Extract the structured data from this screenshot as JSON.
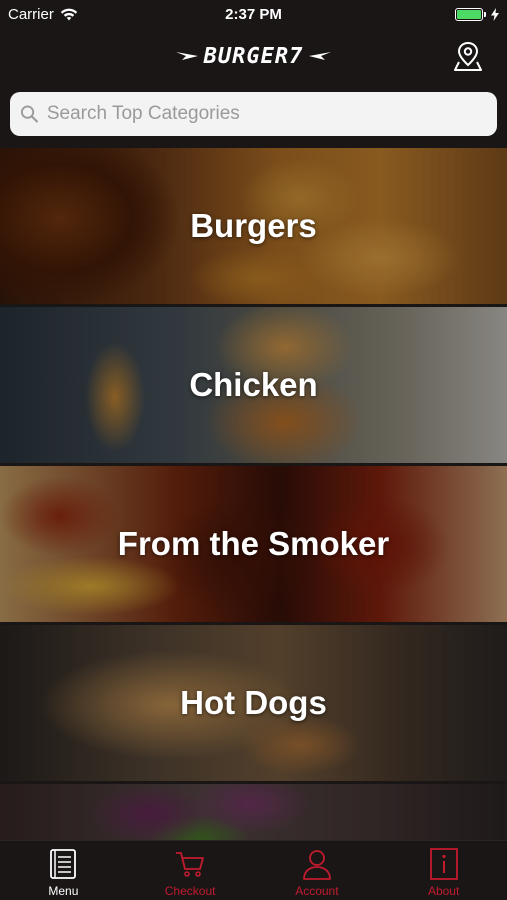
{
  "status_bar": {
    "carrier": "Carrier",
    "time": "2:37 PM"
  },
  "header": {
    "logo_text": "BURGER7"
  },
  "search": {
    "placeholder": "Search Top Categories"
  },
  "categories": [
    {
      "label": "Burgers"
    },
    {
      "label": "Chicken"
    },
    {
      "label": "From the Smoker"
    },
    {
      "label": "Hot Dogs"
    },
    {
      "label": ""
    }
  ],
  "tabs": [
    {
      "label": "Menu",
      "icon": "menu-book-icon"
    },
    {
      "label": "Checkout",
      "icon": "cart-icon"
    },
    {
      "label": "Account",
      "icon": "person-icon"
    },
    {
      "label": "About",
      "icon": "info-icon"
    }
  ],
  "colors": {
    "background": "#1a1616",
    "accent": "#c21b2e",
    "battery": "#4cd964"
  }
}
